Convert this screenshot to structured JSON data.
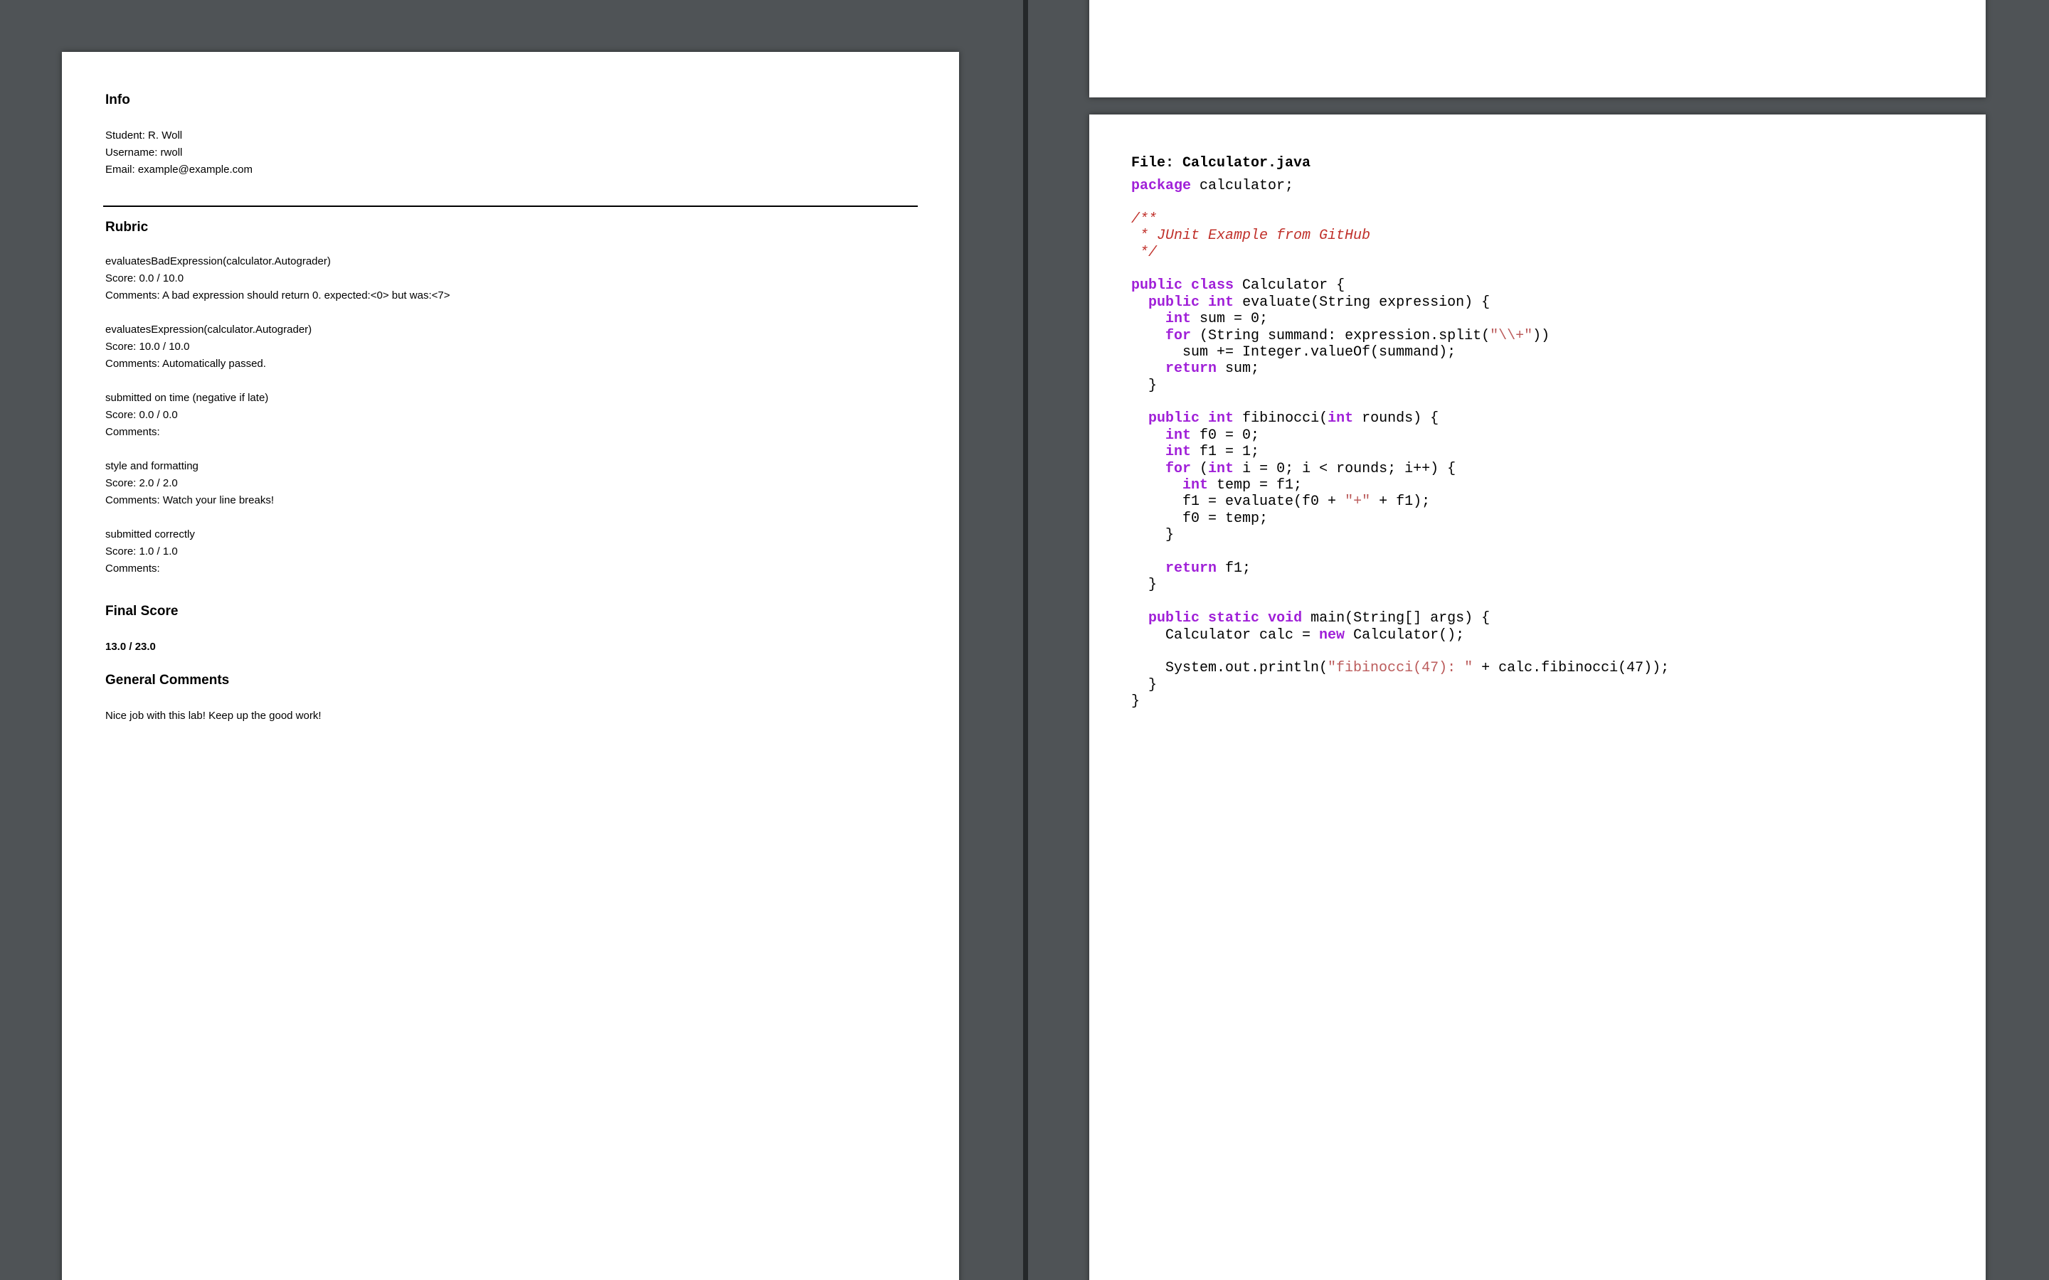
{
  "report": {
    "info_title": "Info",
    "student": "Student: R. Woll",
    "username": "Username: rwoll",
    "email": "Email: example@example.com",
    "rubric_title": "Rubric",
    "rubric": [
      {
        "name": "evaluatesBadExpression(calculator.Autograder)",
        "score": "Score: 0.0 / 10.0",
        "comments": "Comments: A bad expression should return 0. expected:<0> but was:<7>"
      },
      {
        "name": "evaluatesExpression(calculator.Autograder)",
        "score": "Score: 10.0 / 10.0",
        "comments": "Comments: Automatically passed."
      },
      {
        "name": "submitted on time (negative if late)",
        "score": "Score: 0.0 / 0.0",
        "comments": "Comments:"
      },
      {
        "name": "style and formatting",
        "score": "Score: 2.0 / 2.0",
        "comments": "Comments: Watch your line breaks!"
      },
      {
        "name": "submitted correctly",
        "score": "Score: 1.0 / 1.0",
        "comments": "Comments:"
      }
    ],
    "final_title": "Final Score",
    "final_score": "13.0 / 23.0",
    "general_title": "General Comments",
    "general_text": "Nice job with this lab! Keep up the good work!"
  },
  "code": {
    "file_title": "File: Calculator.java",
    "lines": [
      [
        {
          "t": "package",
          "c": "kw"
        },
        {
          "t": " calculator;"
        }
      ],
      [
        {
          "t": ""
        }
      ],
      [
        {
          "t": "/**",
          "c": "cm"
        }
      ],
      [
        {
          "t": " * JUnit Example from GitHub",
          "c": "cm"
        }
      ],
      [
        {
          "t": " */",
          "c": "cm"
        }
      ],
      [
        {
          "t": ""
        }
      ],
      [
        {
          "t": "public",
          "c": "kw"
        },
        {
          "t": " "
        },
        {
          "t": "class",
          "c": "kw"
        },
        {
          "t": " Calculator {"
        }
      ],
      [
        {
          "t": "  "
        },
        {
          "t": "public",
          "c": "kw"
        },
        {
          "t": " "
        },
        {
          "t": "int",
          "c": "kw"
        },
        {
          "t": " evaluate(String expression) {"
        }
      ],
      [
        {
          "t": "    "
        },
        {
          "t": "int",
          "c": "kw"
        },
        {
          "t": " sum = 0;"
        }
      ],
      [
        {
          "t": "    "
        },
        {
          "t": "for",
          "c": "kw"
        },
        {
          "t": " (String summand: expression.split("
        },
        {
          "t": "\"\\\\+\"",
          "c": "st"
        },
        {
          "t": "))"
        }
      ],
      [
        {
          "t": "      sum += Integer.valueOf(summand);"
        }
      ],
      [
        {
          "t": "    "
        },
        {
          "t": "return",
          "c": "kw"
        },
        {
          "t": " sum;"
        }
      ],
      [
        {
          "t": "  }"
        }
      ],
      [
        {
          "t": ""
        }
      ],
      [
        {
          "t": "  "
        },
        {
          "t": "public",
          "c": "kw"
        },
        {
          "t": " "
        },
        {
          "t": "int",
          "c": "kw"
        },
        {
          "t": " fibinocci("
        },
        {
          "t": "int",
          "c": "kw"
        },
        {
          "t": " rounds) {"
        }
      ],
      [
        {
          "t": "    "
        },
        {
          "t": "int",
          "c": "kw"
        },
        {
          "t": " f0 = 0;"
        }
      ],
      [
        {
          "t": "    "
        },
        {
          "t": "int",
          "c": "kw"
        },
        {
          "t": " f1 = 1;"
        }
      ],
      [
        {
          "t": "    "
        },
        {
          "t": "for",
          "c": "kw"
        },
        {
          "t": " ("
        },
        {
          "t": "int",
          "c": "kw"
        },
        {
          "t": " i = 0; i < rounds; i++) {"
        }
      ],
      [
        {
          "t": "      "
        },
        {
          "t": "int",
          "c": "kw"
        },
        {
          "t": " temp = f1;"
        }
      ],
      [
        {
          "t": "      f1 = evaluate(f0 + "
        },
        {
          "t": "\"+\"",
          "c": "st"
        },
        {
          "t": " + f1);"
        }
      ],
      [
        {
          "t": "      f0 = temp;"
        }
      ],
      [
        {
          "t": "    }"
        }
      ],
      [
        {
          "t": ""
        }
      ],
      [
        {
          "t": "    "
        },
        {
          "t": "return",
          "c": "kw"
        },
        {
          "t": " f1;"
        }
      ],
      [
        {
          "t": "  }"
        }
      ],
      [
        {
          "t": ""
        }
      ],
      [
        {
          "t": "  "
        },
        {
          "t": "public",
          "c": "kw"
        },
        {
          "t": " "
        },
        {
          "t": "static",
          "c": "kw"
        },
        {
          "t": " "
        },
        {
          "t": "void",
          "c": "kw"
        },
        {
          "t": " main(String[] args) {"
        }
      ],
      [
        {
          "t": "    Calculator calc = "
        },
        {
          "t": "new",
          "c": "kw"
        },
        {
          "t": " Calculator();"
        }
      ],
      [
        {
          "t": ""
        }
      ],
      [
        {
          "t": "    System.out.println("
        },
        {
          "t": "\"fibinocci(47): \"",
          "c": "st"
        },
        {
          "t": " + calc.fibinocci(47));"
        }
      ],
      [
        {
          "t": "  }"
        }
      ],
      [
        {
          "t": "}"
        }
      ]
    ]
  },
  "colors": {
    "background": "#4f5356",
    "divider": "#25282a",
    "keyword": "#a020d8",
    "comment": "#c0302a",
    "string": "#bb5b5b"
  }
}
